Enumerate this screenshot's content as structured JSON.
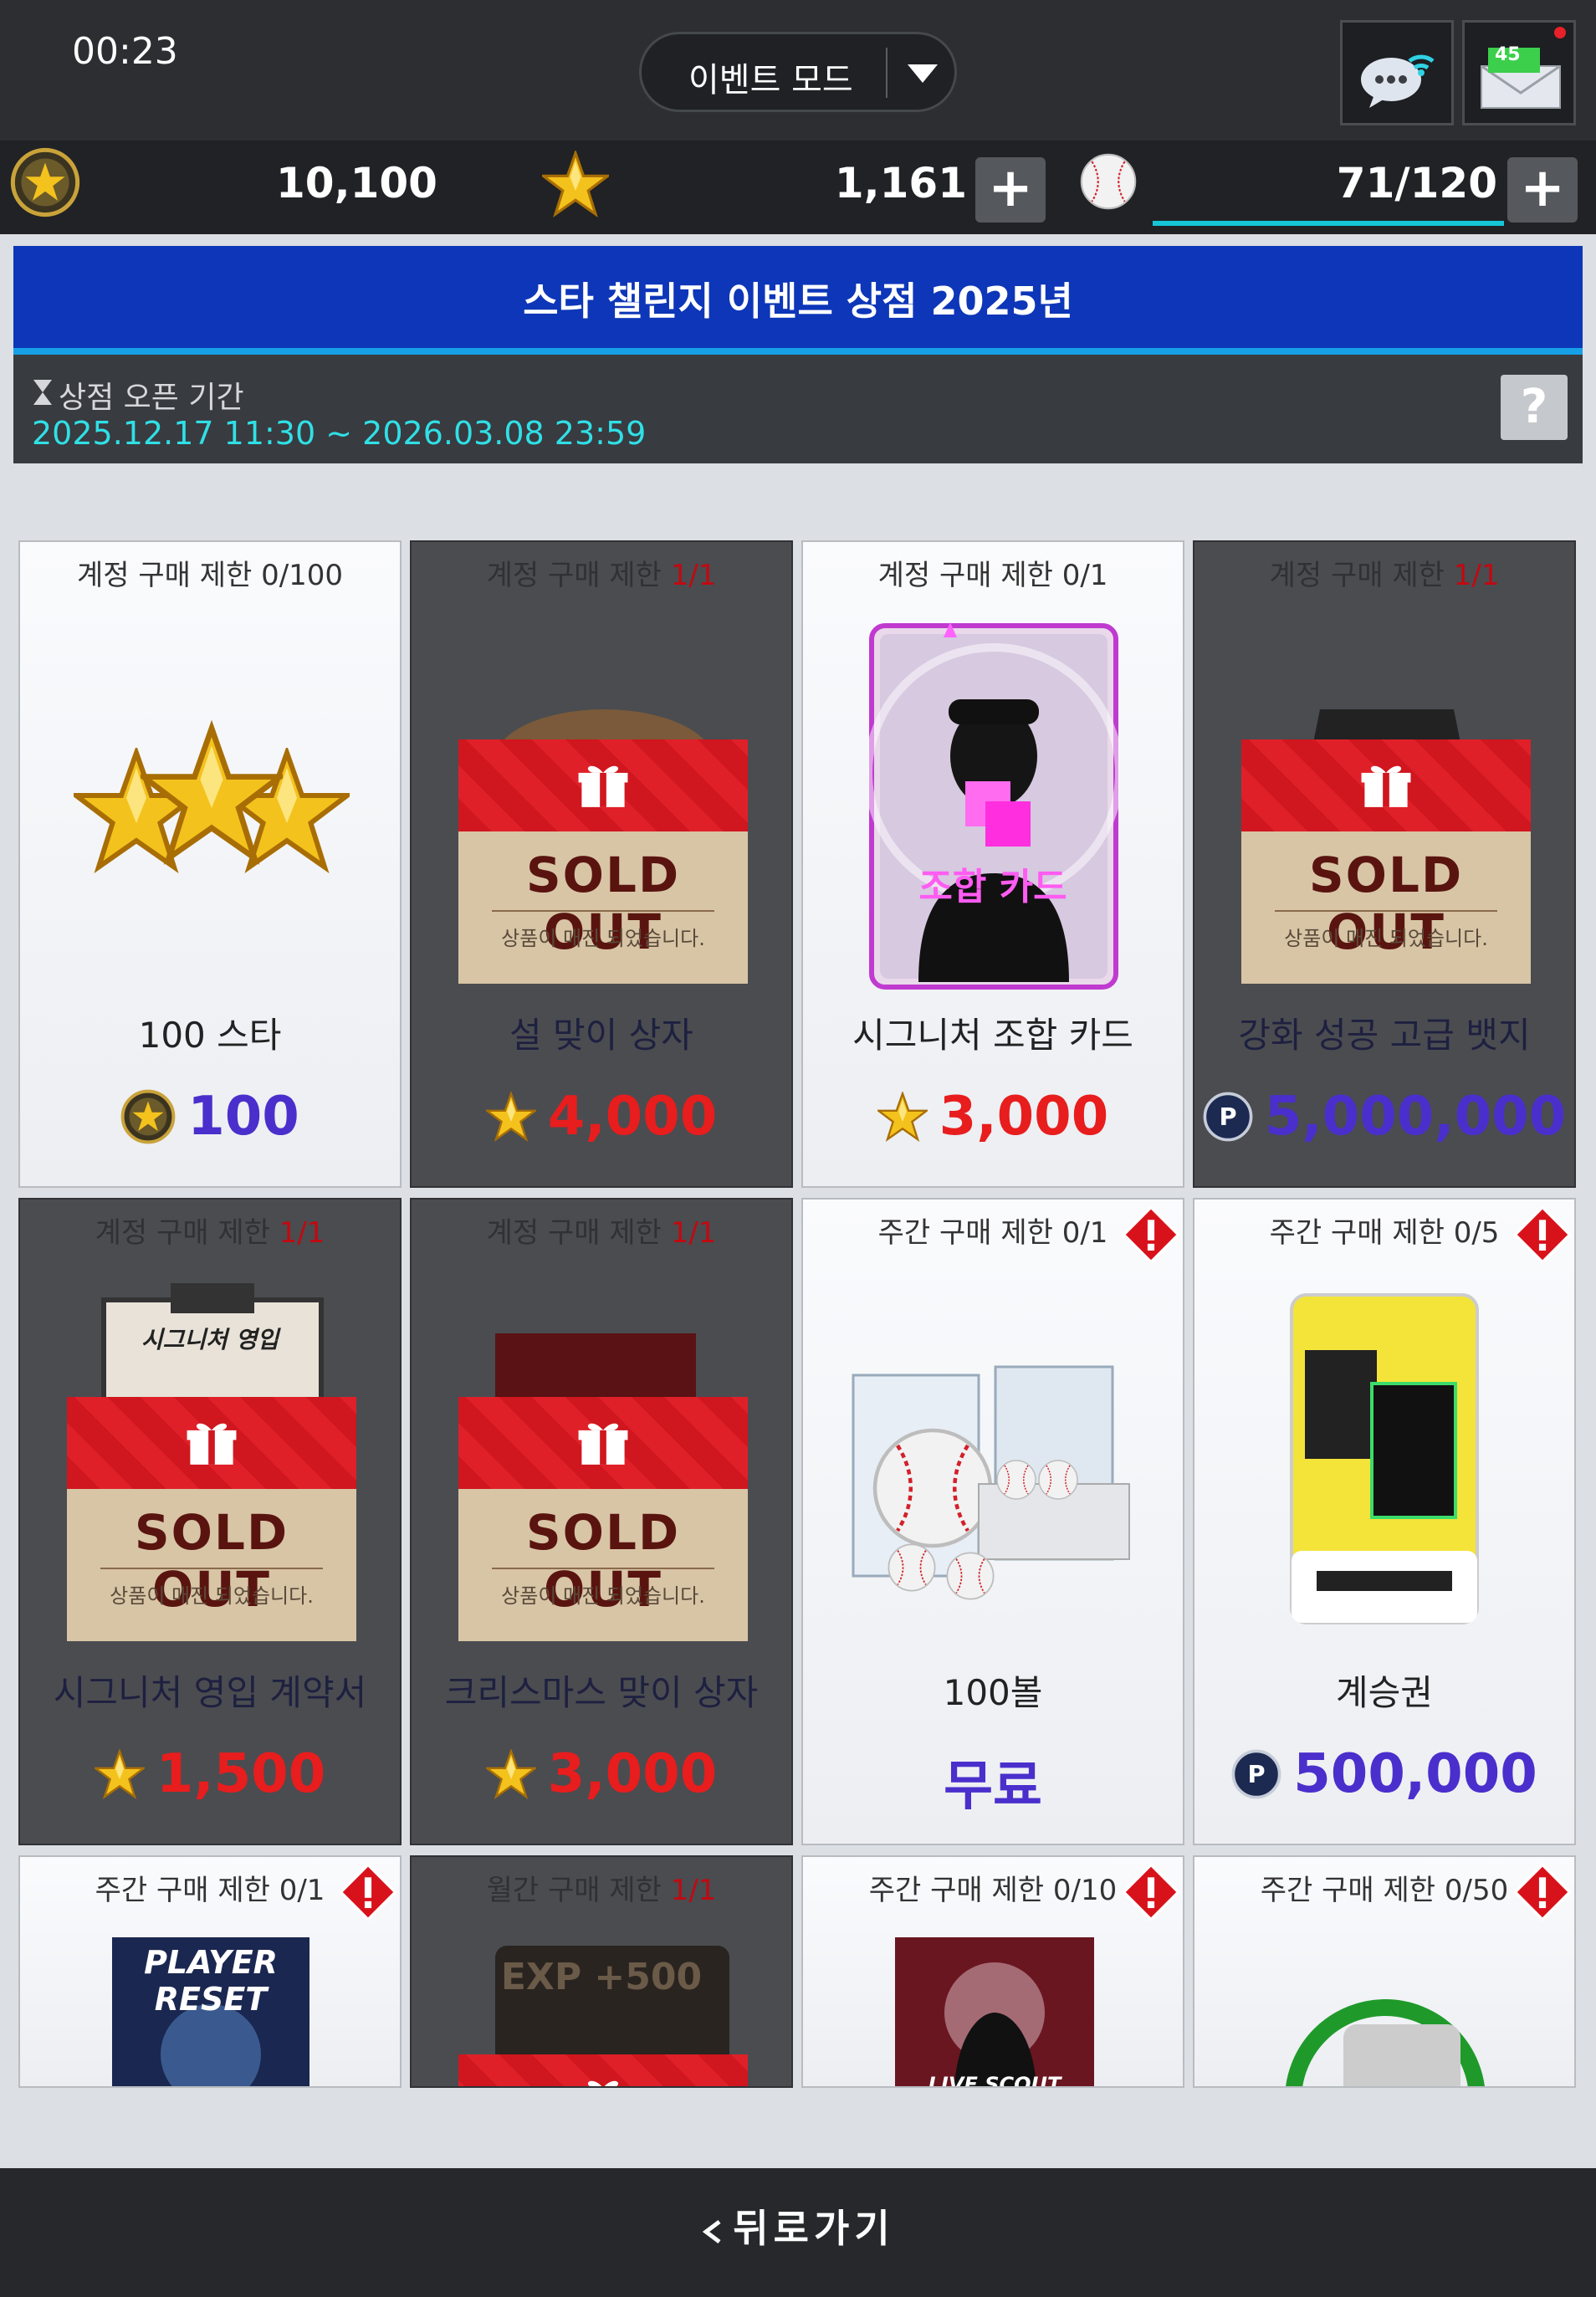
{
  "status": {
    "time": "00:23",
    "mode_label": "이벤트 모드",
    "mail_badge": "45"
  },
  "currencies": {
    "coin": "10,100",
    "star": "1,161",
    "ball": "71/120"
  },
  "banner": {
    "title": "스타 챌린지 이벤트 상점 2025년",
    "period_label": "상점 오픈 기간",
    "period_dates": "2025.12.17 11:30 ~ 2026.03.08 23:59"
  },
  "sold_out": {
    "title": "SOLD OUT",
    "subtitle": "상품이 매진 되었습니다."
  },
  "items": [
    {
      "limit_prefix": "계정 구매 제한",
      "limit_count": "0/100",
      "name": "100 스타",
      "price": "100",
      "currency": "coin",
      "sold_out": false
    },
    {
      "limit_prefix": "계정 구매 제한",
      "limit_count": "1/1",
      "name": "설 맞이 상자",
      "price": "4,000",
      "currency": "star",
      "sold_out": true
    },
    {
      "limit_prefix": "계정 구매 제한",
      "limit_count": "0/1",
      "name": "시그니처 조합 카드",
      "price": "3,000",
      "currency": "star",
      "sold_out": false,
      "card_label": "조합 카드"
    },
    {
      "limit_prefix": "계정 구매 제한",
      "limit_count": "1/1",
      "name": "강화 성공 고급 뱃지",
      "price": "5,000,000",
      "currency": "point",
      "sold_out": true
    },
    {
      "limit_prefix": "계정 구매 제한",
      "limit_count": "1/1",
      "name": "시그니처 영입 계약서",
      "price": "1,500",
      "currency": "star",
      "sold_out": true,
      "doc_label": "시그니처 영입"
    },
    {
      "limit_prefix": "계정 구매 제한",
      "limit_count": "1/1",
      "name": "크리스마스 맞이 상자",
      "price": "3,000",
      "currency": "star",
      "sold_out": true
    },
    {
      "limit_prefix": "주간 구매 제한",
      "limit_count": "0/1",
      "name": "100볼",
      "price": "무료",
      "currency": "free",
      "sold_out": false
    },
    {
      "limit_prefix": "주간 구매 제한",
      "limit_count": "0/5",
      "name": "계승권",
      "price": "500,000",
      "currency": "point",
      "sold_out": false
    },
    {
      "limit_prefix": "주간 구매 제한",
      "limit_count": "0/1",
      "name": "",
      "price": "",
      "currency": "",
      "sold_out": false,
      "art_label": "PLAYER RESET"
    },
    {
      "limit_prefix": "월간 구매 제한",
      "limit_count": "1/1",
      "name": "",
      "price": "",
      "currency": "",
      "sold_out": true,
      "art_label": "EXP +500"
    },
    {
      "limit_prefix": "주간 구매 제한",
      "limit_count": "0/10",
      "name": "",
      "price": "",
      "currency": "",
      "sold_out": false,
      "art_label": "LIVE SCOUT"
    },
    {
      "limit_prefix": "주간 구매 제한",
      "limit_count": "0/50",
      "name": "",
      "price": "",
      "currency": "",
      "sold_out": false
    }
  ],
  "footer": {
    "back_label": "뒤로가기"
  },
  "colors": {
    "accent_cyan": "#2fe0e6",
    "price_red": "#e81d1d",
    "price_purple": "#4a2fcc",
    "banner_blue": "#0d36b8"
  }
}
